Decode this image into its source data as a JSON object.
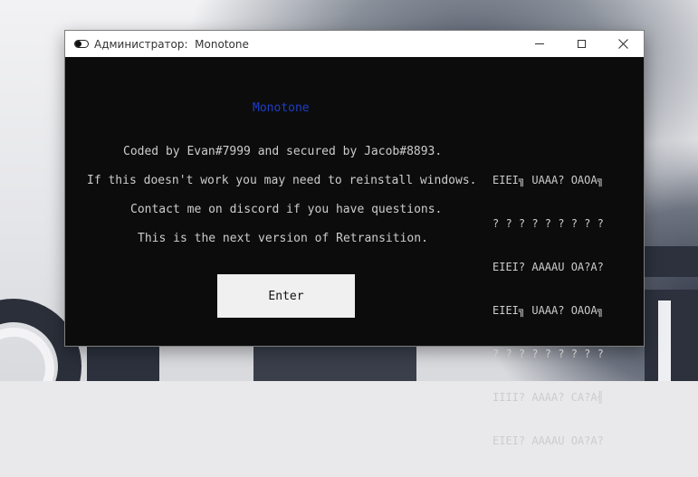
{
  "window": {
    "title": "Администратор:  Monotone",
    "controls": {
      "minimize": "minimize-icon",
      "maximize": "maximize-icon",
      "close": "close-icon"
    }
  },
  "console": {
    "app_name": "Monotone",
    "lines": [
      "Coded by Evan#7999 and secured by Jacob#8893.",
      "If this doesn't work you may need to reinstall windows.",
      "Contact me on discord if you have questions.",
      "This is the next version of Retransition."
    ],
    "enter_label": "Enter",
    "garbled": [
      "EIEI╗ UAAA? OAOA╗",
      "? ? ? ? ? ? ? ? ?",
      "EIEI? AAAAU OA?A?",
      "EIEI╗ UAAA? OAOA╗",
      "? ? ? ? ? ? ? ? ?",
      "IIII? AAAA? CA?A╢",
      "EIEI? AAAAU OA?A?"
    ]
  },
  "colors": {
    "console_bg": "#0c0c0c",
    "console_text": "#cccccc",
    "accent_blue": "#1e3ec9",
    "button_bg": "#f0f0f0"
  }
}
